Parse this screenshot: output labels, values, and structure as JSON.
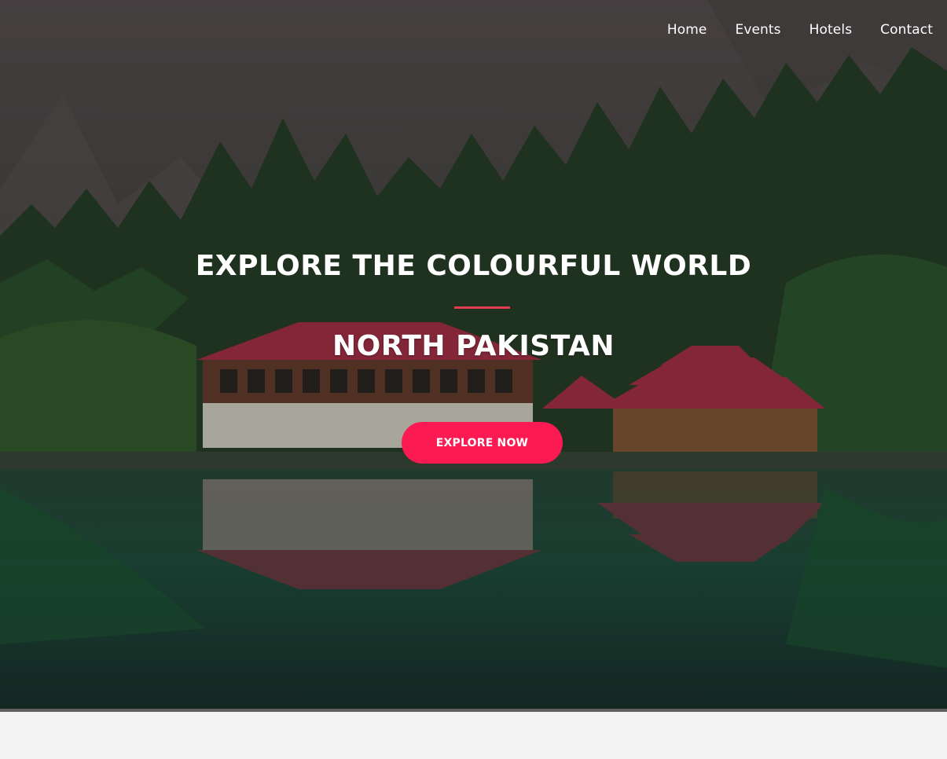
{
  "nav": {
    "items": [
      {
        "label": "Home"
      },
      {
        "label": "Events"
      },
      {
        "label": "Hotels"
      },
      {
        "label": "Contact"
      }
    ]
  },
  "hero": {
    "title": "EXPLORE THE COLOURFUL WORLD",
    "subtitle": "NORTH PAKISTAN",
    "cta_label": "EXPLORE NOW",
    "colors": {
      "accent": "#fb1a52",
      "divider": "#e23a50",
      "roof": "#b0304a"
    }
  }
}
